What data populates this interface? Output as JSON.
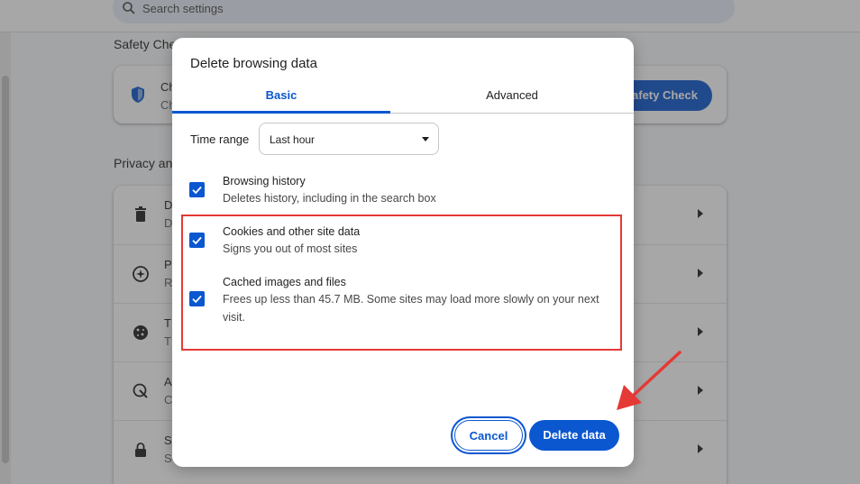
{
  "background": {
    "search_placeholder": "Search settings",
    "safety_section_title": "Safety Che",
    "safety_card": {
      "title": "Ch",
      "subtitle": "Ch",
      "button_label": "Safety Check"
    },
    "privacy_section_title": "Privacy an",
    "privacy_rows": [
      {
        "icon": "trash-icon",
        "title": "D",
        "subtitle": "D"
      },
      {
        "icon": "compass-icon",
        "title": "P",
        "subtitle": "R"
      },
      {
        "icon": "cookie-icon",
        "title": "T",
        "subtitle": "T"
      },
      {
        "icon": "ads-icon",
        "title": "A",
        "subtitle": "C"
      },
      {
        "icon": "lock-icon",
        "title": "S",
        "subtitle": "S"
      }
    ]
  },
  "dialog": {
    "title": "Delete browsing data",
    "tabs": [
      {
        "label": "Basic",
        "selected": true
      },
      {
        "label": "Advanced",
        "selected": false
      }
    ],
    "time_range": {
      "label": "Time range",
      "value": "Last hour"
    },
    "options": [
      {
        "title": "Browsing history",
        "subtitle": "Deletes history, including in the search box",
        "checked": true
      },
      {
        "title": "Cookies and other site data",
        "subtitle": "Signs you out of most sites",
        "checked": true
      },
      {
        "title": "Cached images and files",
        "subtitle": "Frees up less than 45.7 MB. Some sites may load more slowly on your next visit.",
        "checked": true
      }
    ],
    "cancel_label": "Cancel",
    "delete_label": "Delete data"
  },
  "colors": {
    "accent": "#0b57d0",
    "annotation": "#e53935"
  }
}
